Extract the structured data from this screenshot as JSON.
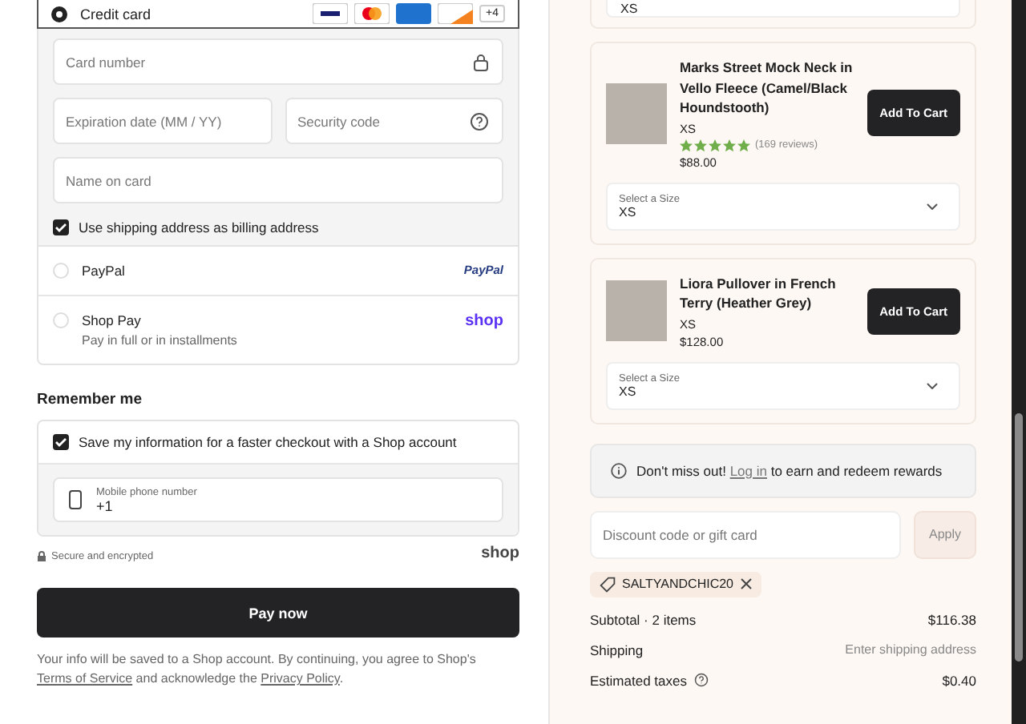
{
  "payment": {
    "credit_card": {
      "label": "Credit card",
      "selected": true,
      "more_cards": "+4",
      "field_rows": [
        [
          {
            "placeholder": "Card number",
            "kind": "lock"
          }
        ],
        [
          {
            "placeholder": "Expiration date (MM / YY)",
            "kind": "plain"
          },
          {
            "placeholder": "Security code",
            "kind": "help"
          }
        ],
        [
          {
            "placeholder": "Name on card",
            "kind": "plain"
          }
        ]
      ],
      "billing": {
        "label": "Use shipping address as billing address",
        "checked": true
      }
    },
    "other_methods": [
      {
        "label": "PayPal",
        "selected": false,
        "kind": "paypal",
        "brand": "PayPal"
      },
      {
        "label": "Shop Pay",
        "sublabel": "Pay in full or in installments",
        "selected": false,
        "kind": "shop",
        "brand": "shop"
      }
    ]
  },
  "remember": {
    "heading": "Remember me",
    "save": {
      "label": "Save my information for a faster checkout with a Shop account",
      "checked": true
    },
    "phone": {
      "label": "Mobile phone number",
      "value": "+1"
    }
  },
  "secure": "Secure and encrypted",
  "shop_logo": "shop",
  "pay_button": "Pay now",
  "legal": {
    "before": "Your info will be saved to a Shop account. By continuing, you agree to Shop's",
    "link1": "Terms of Service",
    "middle": "and acknowledge the",
    "link2": "Privacy Policy",
    "after": "."
  },
  "previous_size_value": "XS",
  "products": [
    {
      "name": "Marks Street Mock Neck in Vello Fleece (Camel/Black Houndstooth)",
      "size": "XS",
      "stars": 5,
      "reviews": "(169 reviews)",
      "price": "$88.00",
      "button": "Add To Cart",
      "size_select": {
        "label": "Select a Size",
        "value": "XS"
      }
    },
    {
      "name": "Liora Pullover in French Terry (Heather Grey)",
      "size": "XS",
      "price": "$128.00",
      "button": "Add To Cart",
      "size_select": {
        "label": "Select a Size",
        "value": "XS"
      }
    }
  ],
  "rewards": {
    "before": "Don't miss out!",
    "link": "Log in",
    "after": "to earn and redeem rewards"
  },
  "discount": {
    "placeholder": "Discount code or gift card",
    "button": "Apply",
    "applied_code": "SALTYANDCHIC20"
  },
  "summary": [
    {
      "label": "Subtotal · 2 items",
      "value": "$116.38",
      "muted": false,
      "help": false
    },
    {
      "label": "Shipping",
      "value": "Enter shipping address",
      "muted": true,
      "help": false
    },
    {
      "label": "Estimated taxes",
      "value": "$0.40",
      "muted": false,
      "help": true
    }
  ]
}
